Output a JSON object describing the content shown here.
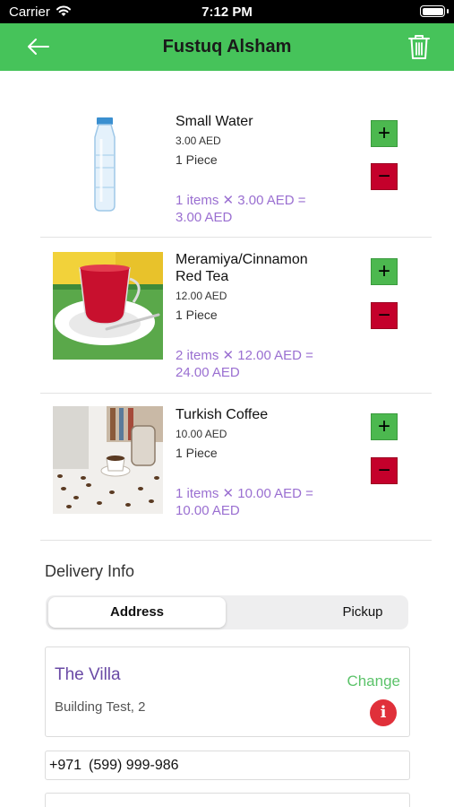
{
  "status_bar": {
    "carrier": "Carrier",
    "time": "7:12 PM"
  },
  "header": {
    "title": "Fustuq Alsham",
    "back_icon": "arrow-left-icon",
    "trash_icon": "trash-icon",
    "background": "#46c35a"
  },
  "cart": {
    "items": [
      {
        "name": "Small Water",
        "price": "3.00 AED",
        "unit": "1 Piece",
        "total": "1 items ✕ 3.00 AED = 3.00 AED",
        "image": "water-bottle"
      },
      {
        "name": "Meramiya/Cinnamon Red Tea",
        "price": "12.00 AED",
        "unit": "1 Piece",
        "total": "2 items ✕ 12.00 AED = 24.00 AED",
        "image": "red-tea-cup"
      },
      {
        "name": "Turkish Coffee",
        "price": "10.00 AED",
        "unit": "1 Piece",
        "total": "1 items ✕ 10.00 AED = 10.00 AED",
        "image": "coffee-cup"
      }
    ],
    "plus_symbol": "+",
    "minus_symbol": "−",
    "plus_color": "#4cb84f",
    "minus_color": "#c4002b"
  },
  "delivery": {
    "title": "Delivery Info",
    "tabs": [
      "Address",
      "Pickup"
    ],
    "selected_tab": "Address",
    "address": {
      "name": "The Villa",
      "line": "Building Test, 2",
      "change_label": "Change",
      "info_symbol": "i"
    },
    "phone": {
      "code": "+971",
      "number": "(599) 999-986"
    }
  }
}
